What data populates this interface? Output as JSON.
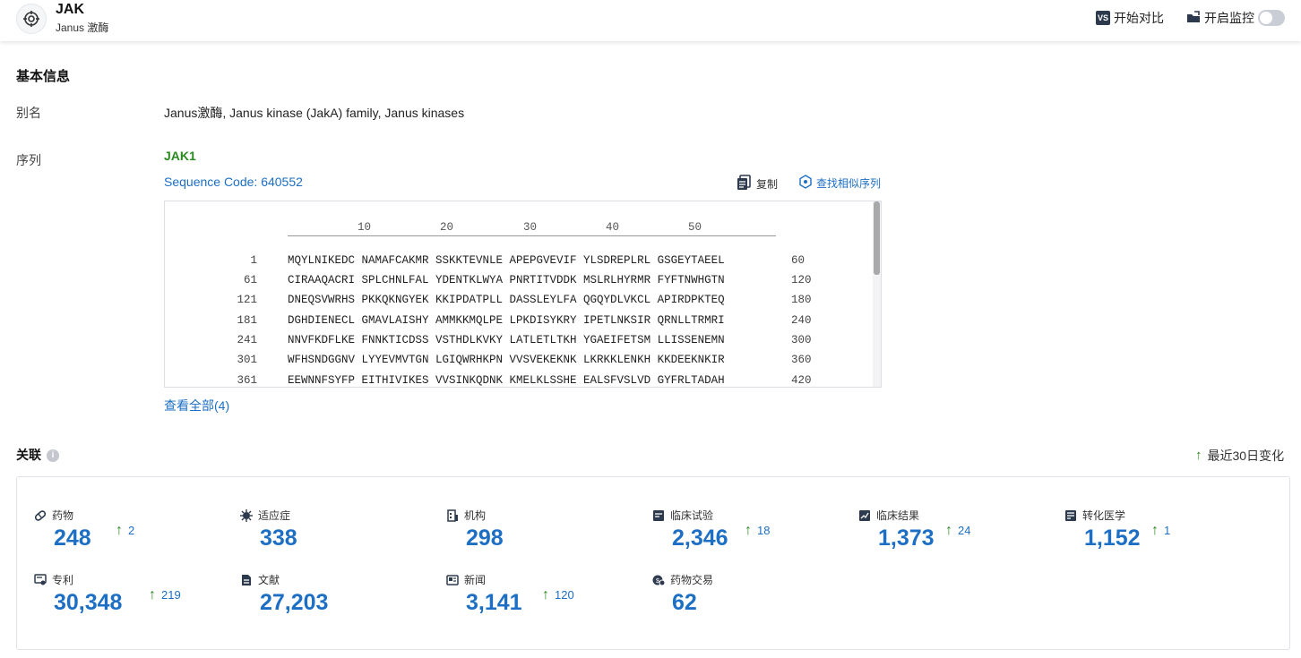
{
  "header": {
    "title": "JAK",
    "subtitle": "Janus 激酶",
    "compare_label": "开始对比",
    "compare_icon_text": "VS",
    "monitor_label": "开启监控"
  },
  "basic": {
    "section_title": "基本信息",
    "alias_label": "别名",
    "alias_value": "Janus激酶,  Janus kinase (JakA) family,  Janus kinases",
    "seq_label": "序列",
    "seq_name": "JAK1",
    "seq_code": "Sequence Code: 640552",
    "copy_label": "复制",
    "find_similar_label": "查找相似序列",
    "view_all": "查看全部(4)",
    "ruler": [
      "10",
      "20",
      "30",
      "40",
      "50"
    ],
    "rows": [
      {
        "start": "1",
        "seq": "MQYLNIKEDC NAMAFCAKMR SSKKTEVNLE APEPGVEVIF YLSDREPLRL GSGEYTAEEL",
        "end": "60"
      },
      {
        "start": "61",
        "seq": "CIRAAQACRI SPLCHNLFAL YDENTKLWYA PNRTITVDDK MSLRLHYRMR FYFTNWHGTN",
        "end": "120"
      },
      {
        "start": "121",
        "seq": "DNEQSVWRHS PKKQKNGYEK KKIPDATPLL DASSLEYLFA QGQYDLVKCL APIRDPKTEQ",
        "end": "180"
      },
      {
        "start": "181",
        "seq": "DGHDIENECL GMAVLAISHY AMMKKMQLPE LPKDISYKRY IPETLNKSIR QRNLLTRMRI",
        "end": "240"
      },
      {
        "start": "241",
        "seq": "NNVFKDFLKE FNNKTICDSS VSTHDLKVKY LATLETLTKH YGAEIFETSM LLISSENEMN",
        "end": "300"
      },
      {
        "start": "301",
        "seq": "WFHSNDGGNV LYYEVMVTGN LGIQWRHKPN VVSVEKEKNK LKRKKLENKH KKDEEKNKIR",
        "end": "360"
      },
      {
        "start": "361",
        "seq": "EEWNNFSYFP EITHIVIKES VVSINKQDNK KMELKLSSHE EALSFVSLVD GYFRLTADAH",
        "end": "420"
      }
    ]
  },
  "related": {
    "section_title": "关联",
    "info_icon": "i",
    "change_label": "最近30日变化",
    "stats": [
      {
        "label": "药物",
        "icon": "pill-icon",
        "value": "248",
        "delta": "2"
      },
      {
        "label": "适应症",
        "icon": "virus-icon",
        "value": "338",
        "delta": ""
      },
      {
        "label": "机构",
        "icon": "building-icon",
        "value": "298",
        "delta": ""
      },
      {
        "label": "临床试验",
        "icon": "clinical-trial-icon",
        "value": "2,346",
        "delta": "18"
      },
      {
        "label": "临床结果",
        "icon": "clinical-result-icon",
        "value": "1,373",
        "delta": "24"
      },
      {
        "label": "转化医学",
        "icon": "translational-icon",
        "value": "1,152",
        "delta": "1"
      },
      {
        "label": "专利",
        "icon": "patent-icon",
        "value": "30,348",
        "delta": "219"
      },
      {
        "label": "文献",
        "icon": "document-icon",
        "value": "27,203",
        "delta": ""
      },
      {
        "label": "新闻",
        "icon": "news-icon",
        "value": "3,141",
        "delta": "120"
      },
      {
        "label": "药物交易",
        "icon": "deal-icon",
        "value": "62",
        "delta": ""
      }
    ]
  },
  "colors": {
    "accent": "#1c6fc4",
    "up": "#2a8a1f"
  }
}
